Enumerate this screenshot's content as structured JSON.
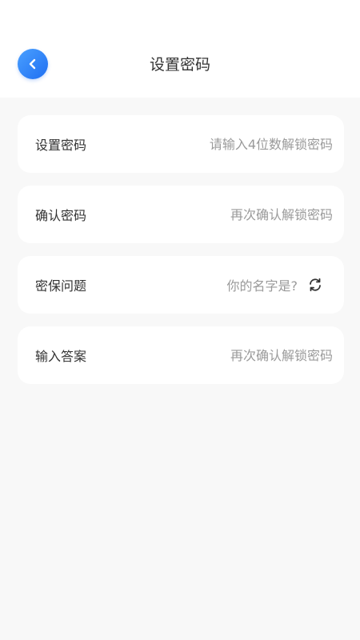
{
  "header": {
    "title": "设置密码",
    "back_icon": "chevron-left-icon"
  },
  "form": {
    "password": {
      "label": "设置密码",
      "placeholder": "请输入4位数解锁密码",
      "value": ""
    },
    "confirm": {
      "label": "确认密码",
      "placeholder": "再次确认解锁密码",
      "value": ""
    },
    "question": {
      "label": "密保问题",
      "value": "你的名字是?",
      "refresh_icon": "refresh-icon"
    },
    "answer": {
      "label": "输入答案",
      "placeholder": "再次确认解锁密码",
      "value": ""
    }
  },
  "colors": {
    "accent": "#2a7cf7",
    "background": "#f8f8f8",
    "card": "#ffffff",
    "text": "#333333",
    "placeholder": "#9a9a9a"
  }
}
